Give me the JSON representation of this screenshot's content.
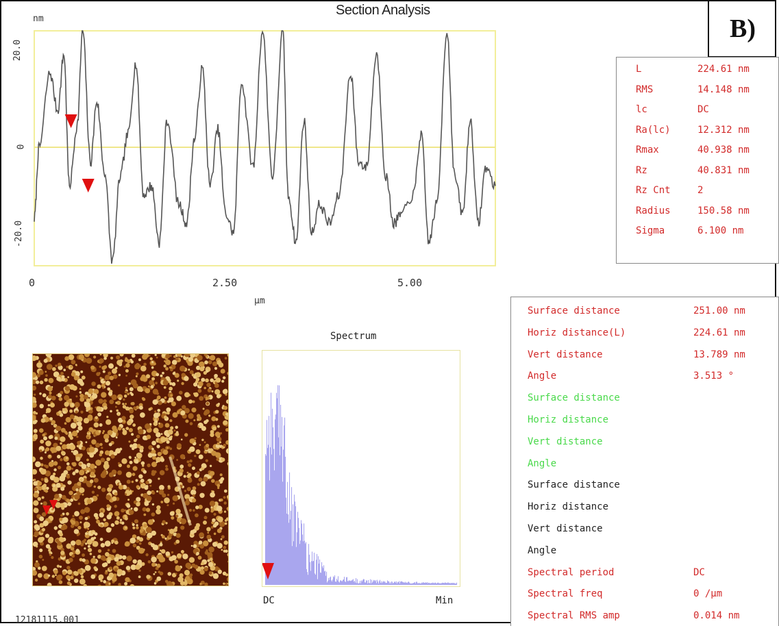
{
  "window": {
    "title": "Section Analysis",
    "panel_tag": "B)",
    "footer_id": "12181115.001"
  },
  "section_profile": {
    "y_unit": "nm",
    "y_ticks": [
      "20.0",
      "0",
      "-20.0"
    ],
    "x_ticks": [
      "0",
      "2.50",
      "5.00"
    ],
    "x_unit": "μm",
    "y_range": [
      -25,
      25
    ],
    "x_range": [
      0,
      5.9
    ],
    "cursor_positions_um": [
      0.47,
      0.69
    ]
  },
  "roughness_stats": [
    {
      "label": "L",
      "value": "224.61 nm"
    },
    {
      "label": "RMS",
      "value": "14.148 nm"
    },
    {
      "label": "lc",
      "value": "DC"
    },
    {
      "label": "Ra(lc)",
      "value": "12.312 nm"
    },
    {
      "label": "Rmax",
      "value": "40.938 nm"
    },
    {
      "label": "Rz",
      "value": "40.831 nm"
    },
    {
      "label": "Rz Cnt",
      "value": "2"
    },
    {
      "label": "Radius",
      "value": "150.58 nm"
    },
    {
      "label": "Sigma",
      "value": "6.100 nm"
    }
  ],
  "measurements": [
    {
      "label": "Surface distance",
      "value": "251.00 nm",
      "color": "red"
    },
    {
      "label": "Horiz distance(L)",
      "value": "224.61 nm",
      "color": "red"
    },
    {
      "label": "Vert distance",
      "value": "13.789 nm",
      "color": "red"
    },
    {
      "label": "Angle",
      "value": "3.513 °",
      "color": "red"
    },
    {
      "label": "Surface distance",
      "value": "",
      "color": "green"
    },
    {
      "label": "Horiz distance",
      "value": "",
      "color": "green"
    },
    {
      "label": "Vert distance",
      "value": "",
      "color": "green"
    },
    {
      "label": "Angle",
      "value": "",
      "color": "green"
    },
    {
      "label": "Surface distance",
      "value": "",
      "color": "black"
    },
    {
      "label": "Horiz distance",
      "value": "",
      "color": "black"
    },
    {
      "label": "Vert distance",
      "value": "",
      "color": "black"
    },
    {
      "label": "Angle",
      "value": "",
      "color": "black"
    },
    {
      "label": "Spectral period",
      "value": "DC",
      "color": "red"
    },
    {
      "label": "Spectral freq",
      "value": "0 /μm",
      "color": "red"
    },
    {
      "label": "Spectral RMS amp",
      "value": "0.014 nm",
      "color": "red"
    }
  ],
  "spectrum": {
    "title": "Spectrum",
    "x_left": "DC",
    "x_right": "Min"
  },
  "colors": {
    "profile_line": "#555555",
    "frame_yellow": "#f2ee9a",
    "zero_line": "#efe68a",
    "cursor_red": "#e01010",
    "spectrum_bar": "#a9a6ee",
    "afm_dark": "#5a1a05",
    "afm_light": "#e2b765"
  }
}
